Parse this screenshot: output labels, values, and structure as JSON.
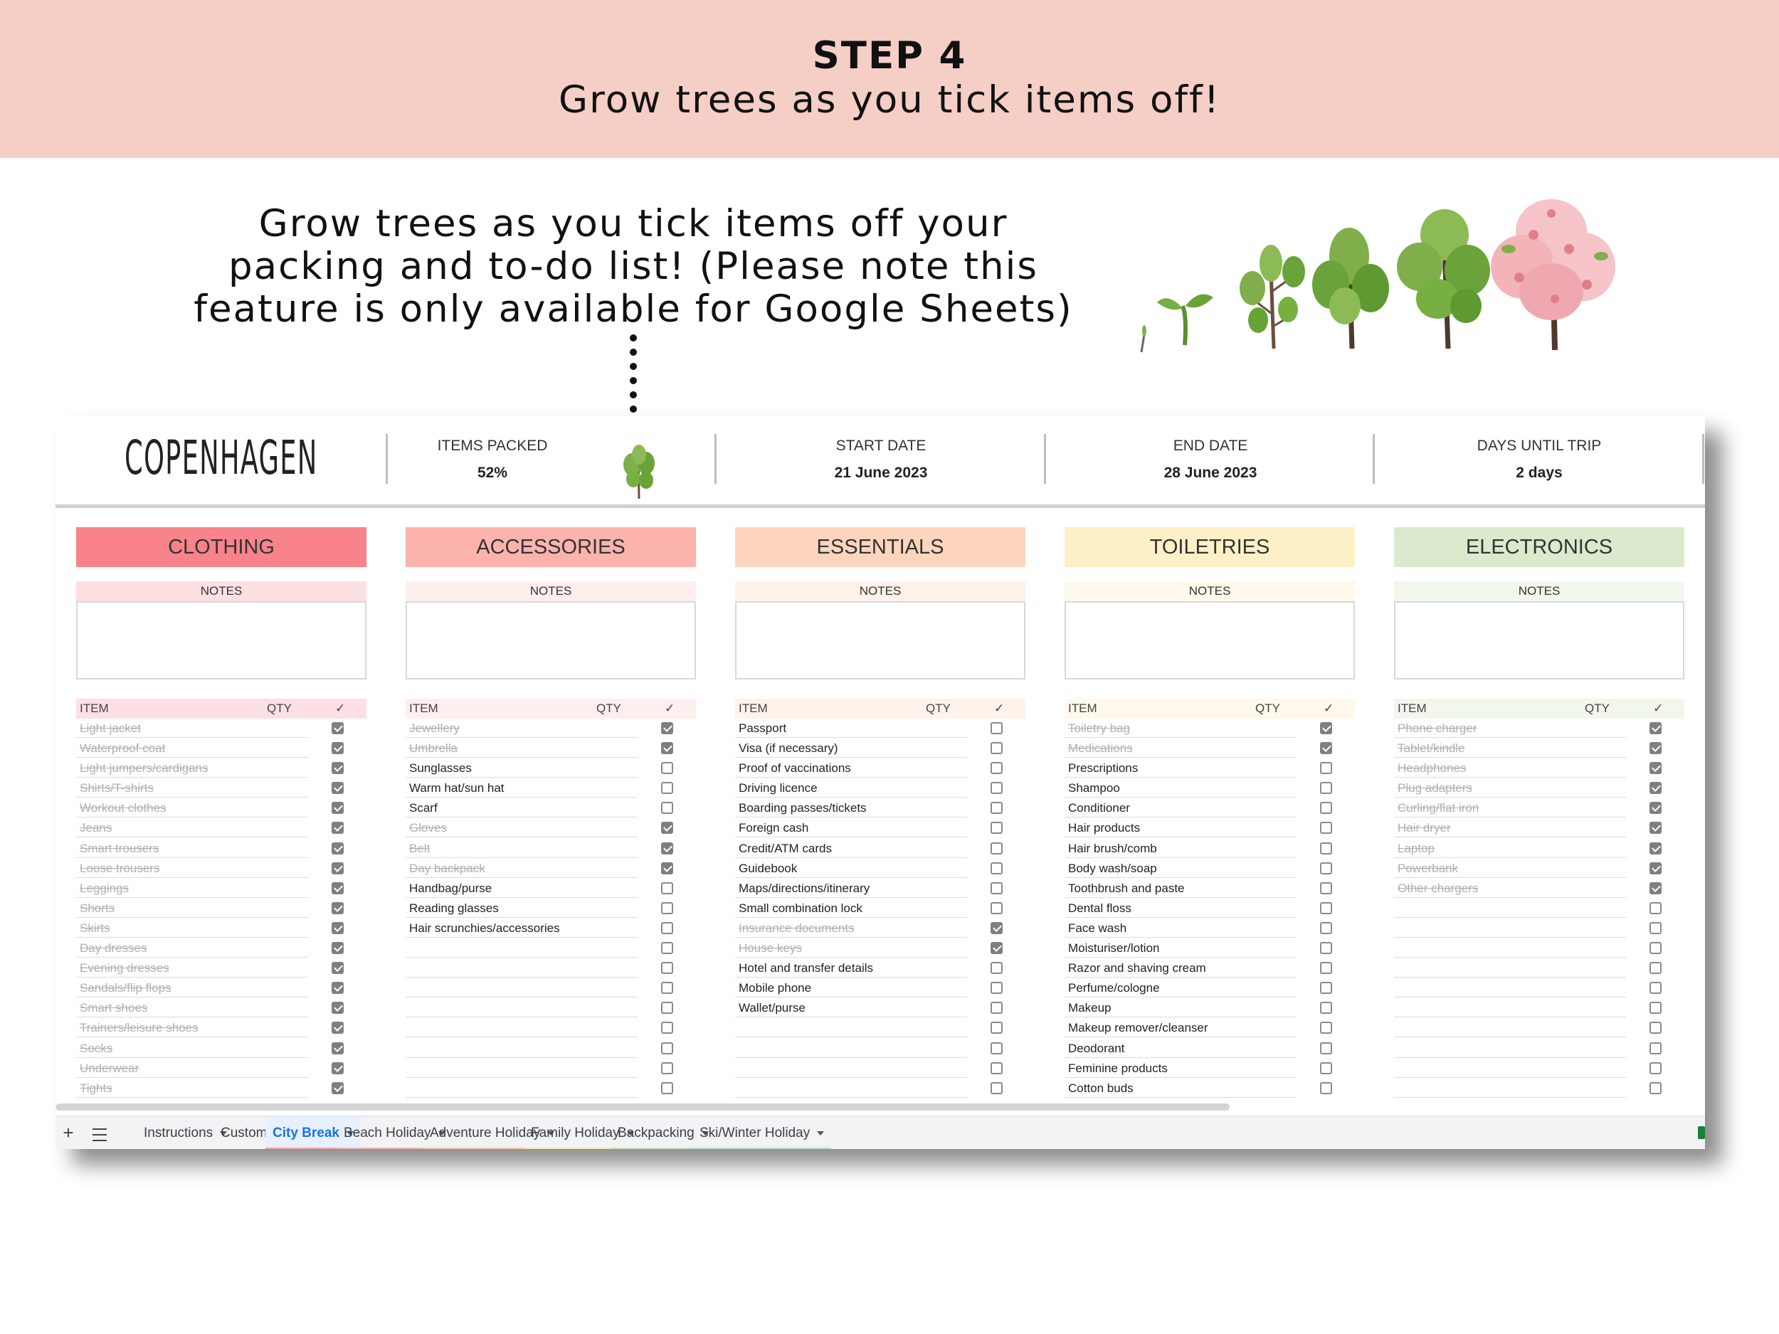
{
  "header": {
    "step": "STEP 4",
    "subtitle": "Grow trees as you tick items off!"
  },
  "explanation": {
    "line1": "Grow trees as you tick items off your",
    "line2": "packing and to-do list! (Please note this",
    "line3": "feature is only available for Google Sheets)"
  },
  "sheet": {
    "city": "COPENHAGEN",
    "items_packed": {
      "label": "ITEMS PACKED",
      "value": "52%"
    },
    "start_date": {
      "label": "START DATE",
      "value": "21 June 2023"
    },
    "end_date": {
      "label": "END DATE",
      "value": "28 June 2023"
    },
    "days_until": {
      "label": "DAYS UNTIL TRIP",
      "value": "2 days"
    },
    "notes_label": "NOTES",
    "col_item": "ITEM",
    "col_qty": "QTY",
    "col_check": "✓",
    "categories": [
      {
        "title": "CLOTHING",
        "color": "#f8838b",
        "notes_color": "#fde0e3",
        "list_color": "#fde0e3",
        "items": [
          {
            "label": "Light jacket",
            "checked": true
          },
          {
            "label": "Waterproof coat",
            "checked": true
          },
          {
            "label": "Light jumpers/cardigans",
            "checked": true
          },
          {
            "label": "Shirts/T-shirts",
            "checked": true
          },
          {
            "label": "Workout clothes",
            "checked": true
          },
          {
            "label": "Jeans",
            "checked": true
          },
          {
            "label": "Smart trousers",
            "checked": true
          },
          {
            "label": "Loose trousers",
            "checked": true
          },
          {
            "label": "Leggings",
            "checked": true
          },
          {
            "label": "Shorts",
            "checked": true
          },
          {
            "label": "Skirts",
            "checked": true
          },
          {
            "label": "Day dresses",
            "checked": true
          },
          {
            "label": "Evening dresses",
            "checked": true
          },
          {
            "label": "Sandals/flip flops",
            "checked": true
          },
          {
            "label": "Smart shoes",
            "checked": true
          },
          {
            "label": "Trainers/leisure shoes",
            "checked": true
          },
          {
            "label": "Socks",
            "checked": true
          },
          {
            "label": "Underwear",
            "checked": true
          },
          {
            "label": "Tights",
            "checked": true
          }
        ]
      },
      {
        "title": "ACCESSORIES",
        "color": "#fcb3ac",
        "notes_color": "#feeeed",
        "list_color": "#feeeed",
        "items": [
          {
            "label": "Jewellery",
            "checked": true
          },
          {
            "label": "Umbrella",
            "checked": true
          },
          {
            "label": "Sunglasses",
            "checked": false
          },
          {
            "label": "Warm hat/sun hat",
            "checked": false
          },
          {
            "label": "Scarf",
            "checked": false
          },
          {
            "label": "Gloves",
            "checked": true
          },
          {
            "label": "Belt",
            "checked": true
          },
          {
            "label": "Day backpack",
            "checked": true
          },
          {
            "label": "Handbag/purse",
            "checked": false
          },
          {
            "label": "Reading glasses",
            "checked": false
          },
          {
            "label": "Hair scrunchies/accessories",
            "checked": false
          },
          {
            "label": "",
            "checked": false
          },
          {
            "label": "",
            "checked": false
          },
          {
            "label": "",
            "checked": false
          },
          {
            "label": "",
            "checked": false
          },
          {
            "label": "",
            "checked": false
          },
          {
            "label": "",
            "checked": false
          },
          {
            "label": "",
            "checked": false
          },
          {
            "label": "",
            "checked": false
          }
        ]
      },
      {
        "title": "ESSENTIALS",
        "color": "#fdd5bd",
        "notes_color": "#fef2ea",
        "list_color": "#fef2ea",
        "items": [
          {
            "label": "Passport",
            "checked": false
          },
          {
            "label": "Visa (if necessary)",
            "checked": false
          },
          {
            "label": "Proof of vaccinations",
            "checked": false
          },
          {
            "label": "Driving licence",
            "checked": false
          },
          {
            "label": "Boarding passes/tickets",
            "checked": false
          },
          {
            "label": "Foreign cash",
            "checked": false
          },
          {
            "label": "Credit/ATM cards",
            "checked": false
          },
          {
            "label": "Guidebook",
            "checked": false
          },
          {
            "label": "Maps/directions/itinerary",
            "checked": false
          },
          {
            "label": "Small combination lock",
            "checked": false
          },
          {
            "label": "Insurance documents",
            "checked": true
          },
          {
            "label": "House keys",
            "checked": true
          },
          {
            "label": "Hotel and transfer details",
            "checked": false
          },
          {
            "label": "Mobile phone",
            "checked": false
          },
          {
            "label": "Wallet/purse",
            "checked": false
          },
          {
            "label": "",
            "checked": false
          },
          {
            "label": "",
            "checked": false
          },
          {
            "label": "",
            "checked": false
          },
          {
            "label": "",
            "checked": false
          }
        ]
      },
      {
        "title": "TOILETRIES",
        "color": "#fdf0c6",
        "notes_color": "#fef9ea",
        "list_color": "#fef9ea",
        "items": [
          {
            "label": "Toiletry bag",
            "checked": true
          },
          {
            "label": "Medications",
            "checked": true
          },
          {
            "label": "Prescriptions",
            "checked": false
          },
          {
            "label": "Shampoo",
            "checked": false
          },
          {
            "label": "Conditioner",
            "checked": false
          },
          {
            "label": "Hair products",
            "checked": false
          },
          {
            "label": "Hair brush/comb",
            "checked": false
          },
          {
            "label": "Body wash/soap",
            "checked": false
          },
          {
            "label": "Toothbrush and paste",
            "checked": false
          },
          {
            "label": "Dental floss",
            "checked": false
          },
          {
            "label": "Face wash",
            "checked": false
          },
          {
            "label": "Moisturiser/lotion",
            "checked": false
          },
          {
            "label": "Razor and shaving cream",
            "checked": false
          },
          {
            "label": "Perfume/cologne",
            "checked": false
          },
          {
            "label": "Makeup",
            "checked": false
          },
          {
            "label": "Makeup remover/cleanser",
            "checked": false
          },
          {
            "label": "Deodorant",
            "checked": false
          },
          {
            "label": "Feminine products",
            "checked": false
          },
          {
            "label": "Cotton buds",
            "checked": false
          }
        ]
      },
      {
        "title": "ELECTRONICS",
        "color": "#dbeacd",
        "notes_color": "#f1f7ec",
        "list_color": "#f1f7ec",
        "items": [
          {
            "label": "Phone charger",
            "checked": true
          },
          {
            "label": "Tablet/kindle",
            "checked": true
          },
          {
            "label": "Headphones",
            "checked": true
          },
          {
            "label": "Plug adapters",
            "checked": true
          },
          {
            "label": "Curling/flat iron",
            "checked": true
          },
          {
            "label": "Hair dryer",
            "checked": true
          },
          {
            "label": "Laptop",
            "checked": true
          },
          {
            "label": "Powerbank",
            "checked": true
          },
          {
            "label": "Other chargers",
            "checked": true
          },
          {
            "label": "",
            "checked": false
          },
          {
            "label": "",
            "checked": false
          },
          {
            "label": "",
            "checked": false
          },
          {
            "label": "",
            "checked": false
          },
          {
            "label": "",
            "checked": false
          },
          {
            "label": "",
            "checked": false
          },
          {
            "label": "",
            "checked": false
          },
          {
            "label": "",
            "checked": false
          },
          {
            "label": "",
            "checked": false
          },
          {
            "label": "",
            "checked": false
          }
        ]
      }
    ],
    "tabs": [
      {
        "label": "Instructions",
        "active": false,
        "color": ""
      },
      {
        "label": "Custom",
        "active": false,
        "color": ""
      },
      {
        "label": "City Break",
        "active": true,
        "color": "#f4a4ad"
      },
      {
        "label": "Beach Holiday",
        "active": false,
        "color": "#f4b5ad"
      },
      {
        "label": "Adventure Holiday",
        "active": false,
        "color": "#f9cdb4"
      },
      {
        "label": "Family Holiday",
        "active": false,
        "color": "#f6e8a8"
      },
      {
        "label": "Backpacking",
        "active": false,
        "color": "#cfe3bd"
      },
      {
        "label": "Ski/Winter Holiday",
        "active": false,
        "color": "#b7e0d5"
      }
    ]
  }
}
